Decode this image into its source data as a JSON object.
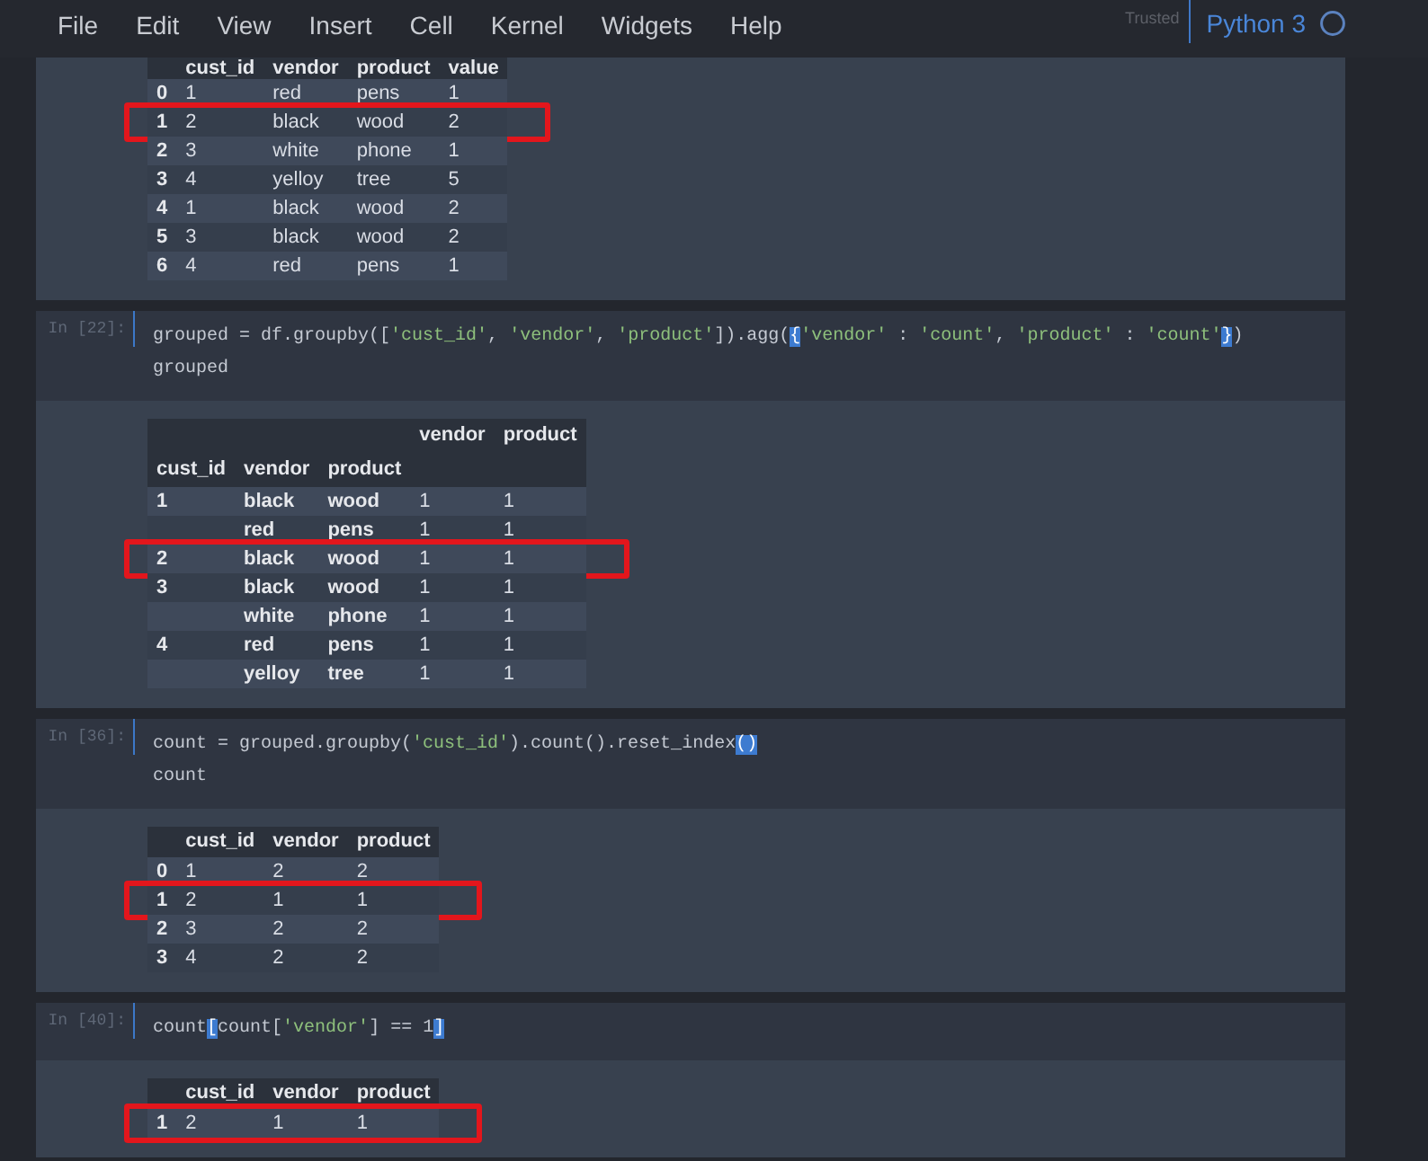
{
  "menu": [
    "File",
    "Edit",
    "View",
    "Insert",
    "Cell",
    "Kernel",
    "Widgets",
    "Help"
  ],
  "trusted": "Trusted",
  "kernel": "Python 3",
  "cells": [
    {
      "output": {
        "table": {
          "kind": "flat",
          "columns": [
            "cust_id",
            "vendor",
            "product",
            "value"
          ],
          "rows": [
            {
              "index": "0",
              "cells": [
                "1",
                "red",
                "pens",
                "1"
              ],
              "highlighted": false
            },
            {
              "index": "1",
              "cells": [
                "2",
                "black",
                "wood",
                "2"
              ],
              "highlighted": true
            },
            {
              "index": "2",
              "cells": [
                "3",
                "white",
                "phone",
                "1"
              ],
              "highlighted": false
            },
            {
              "index": "3",
              "cells": [
                "4",
                "yelloy",
                "tree",
                "5"
              ],
              "highlighted": false
            },
            {
              "index": "4",
              "cells": [
                "1",
                "black",
                "wood",
                "2"
              ],
              "highlighted": false
            },
            {
              "index": "5",
              "cells": [
                "3",
                "black",
                "wood",
                "2"
              ],
              "highlighted": false
            },
            {
              "index": "6",
              "cells": [
                "4",
                "red",
                "pens",
                "1"
              ],
              "highlighted": false
            }
          ]
        }
      }
    },
    {
      "prompt": "In [22]:",
      "code": [
        [
          {
            "kind": "plain",
            "text": "grouped = df.groupby(["
          },
          {
            "kind": "string",
            "text": "'cust_id'"
          },
          {
            "kind": "plain",
            "text": ", "
          },
          {
            "kind": "string",
            "text": "'vendor'"
          },
          {
            "kind": "plain",
            "text": ", "
          },
          {
            "kind": "string",
            "text": "'product'"
          },
          {
            "kind": "plain",
            "text": "]).agg("
          },
          {
            "kind": "match",
            "text": "{"
          },
          {
            "kind": "string",
            "text": "'vendor'"
          },
          {
            "kind": "plain",
            "text": " : "
          },
          {
            "kind": "string",
            "text": "'count'"
          },
          {
            "kind": "plain",
            "text": ", "
          },
          {
            "kind": "string",
            "text": "'product'"
          },
          {
            "kind": "plain",
            "text": " : "
          },
          {
            "kind": "string",
            "text": "'count'"
          },
          {
            "kind": "match",
            "text": "}"
          },
          {
            "kind": "plain",
            "text": ")"
          }
        ],
        [
          {
            "kind": "plain",
            "text": "grouped"
          }
        ]
      ],
      "output": {
        "table": {
          "kind": "multiindex",
          "columns": [
            "vendor",
            "product"
          ],
          "index_names": [
            "cust_id",
            "vendor",
            "product"
          ],
          "rows": [
            {
              "group": "1",
              "index": [
                "black",
                "wood"
              ],
              "cells": [
                "1",
                "1"
              ],
              "highlighted": false
            },
            {
              "index": [
                "red",
                "pens"
              ],
              "cells": [
                "1",
                "1"
              ],
              "highlighted": false
            },
            {
              "group": "2",
              "index": [
                "black",
                "wood"
              ],
              "cells": [
                "1",
                "1"
              ],
              "highlighted": true
            },
            {
              "group": "3",
              "index": [
                "black",
                "wood"
              ],
              "cells": [
                "1",
                "1"
              ],
              "highlighted": false
            },
            {
              "index": [
                "white",
                "phone"
              ],
              "cells": [
                "1",
                "1"
              ],
              "highlighted": false
            },
            {
              "group": "4",
              "index": [
                "red",
                "pens"
              ],
              "cells": [
                "1",
                "1"
              ],
              "highlighted": false
            },
            {
              "index": [
                "yelloy",
                "tree"
              ],
              "cells": [
                "1",
                "1"
              ],
              "highlighted": false
            }
          ]
        }
      }
    },
    {
      "prompt": "In [36]:",
      "code": [
        [
          {
            "kind": "plain",
            "text": "count = grouped.groupby("
          },
          {
            "kind": "string",
            "text": "'cust_id'"
          },
          {
            "kind": "plain",
            "text": ").count().reset_index"
          },
          {
            "kind": "match",
            "text": "()"
          }
        ],
        [
          {
            "kind": "plain",
            "text": "count"
          }
        ]
      ],
      "output": {
        "table": {
          "kind": "flat",
          "columns": [
            "cust_id",
            "vendor",
            "product"
          ],
          "rows": [
            {
              "index": "0",
              "cells": [
                "1",
                "2",
                "2"
              ],
              "highlighted": false
            },
            {
              "index": "1",
              "cells": [
                "2",
                "1",
                "1"
              ],
              "highlighted": true
            },
            {
              "index": "2",
              "cells": [
                "3",
                "2",
                "2"
              ],
              "highlighted": false
            },
            {
              "index": "3",
              "cells": [
                "4",
                "2",
                "2"
              ],
              "highlighted": false
            }
          ]
        }
      }
    },
    {
      "prompt": "In [40]:",
      "code": [
        [
          {
            "kind": "plain",
            "text": "count"
          },
          {
            "kind": "match",
            "text": "["
          },
          {
            "kind": "plain",
            "text": "count["
          },
          {
            "kind": "string",
            "text": "'vendor'"
          },
          {
            "kind": "plain",
            "text": "] == 1"
          },
          {
            "kind": "match",
            "text": "]"
          }
        ]
      ],
      "output": {
        "table": {
          "kind": "flat",
          "columns": [
            "cust_id",
            "vendor",
            "product"
          ],
          "rows": [
            {
              "index": "1",
              "cells": [
                "2",
                "1",
                "1"
              ],
              "highlighted": true
            }
          ]
        }
      }
    }
  ]
}
